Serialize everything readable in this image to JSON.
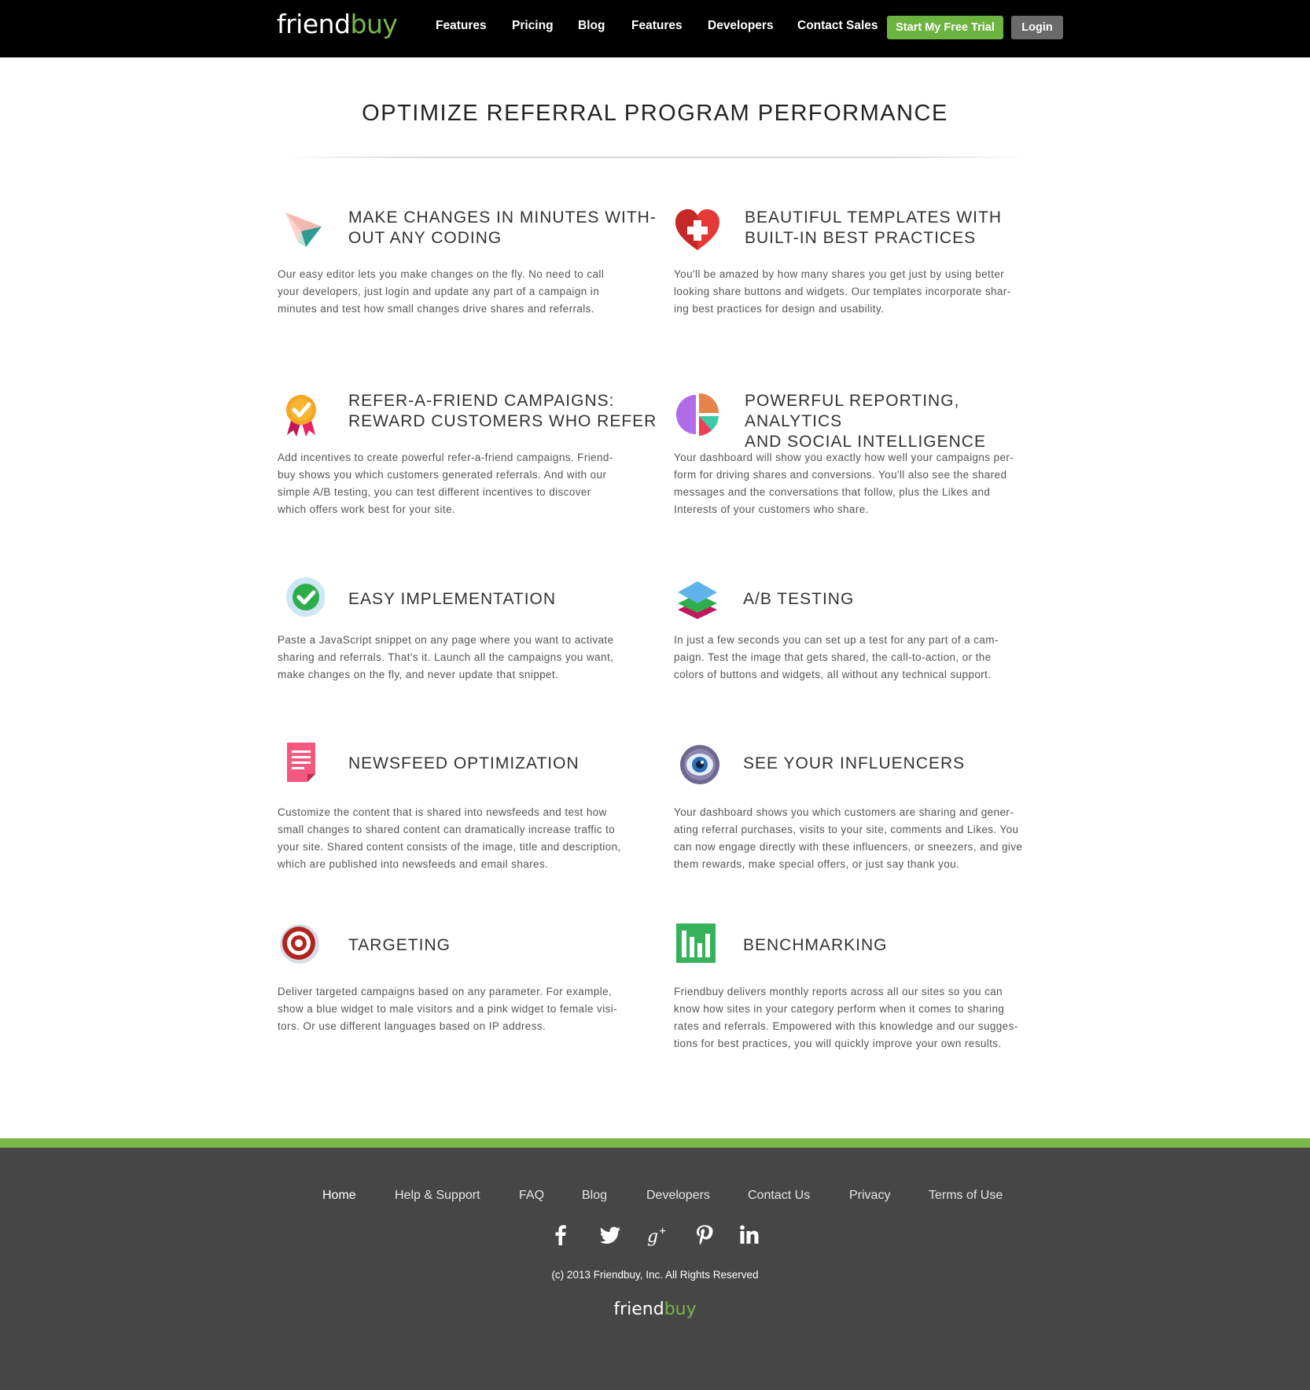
{
  "header": {
    "logo_part1": "friend",
    "logo_part2": "buy",
    "nav": [
      "Features",
      "Pricing",
      "Blog",
      "Features",
      "Developers",
      "Contact Sales"
    ],
    "trial_button": "Start My Free Trial",
    "login_button": "Login"
  },
  "main": {
    "title": "OPTIMIZE REFERRAL PROGRAM PERFORMANCE",
    "features": [
      {
        "icon": "paper-plane-icon",
        "title": "MAKE CHANGES IN MINUTES WITH-\nOUT ANY CODING",
        "body": "Our easy editor lets you make changes on the fly. No need to call\nyour developers, just login and update any part of a campaign in\nminutes and test how small changes drive shares and referrals."
      },
      {
        "icon": "heart-plus-icon",
        "title": "BEAUTIFUL TEMPLATES WITH\nBUILT-IN BEST PRACTICES",
        "body": "You'll be amazed by how many shares you get just by using better\nlooking share buttons and widgets. Our templates incorporate shar-\ning best practices for design and usability."
      },
      {
        "icon": "award-ribbon-icon",
        "title": "REFER-A-FRIEND CAMPAIGNS:\nREWARD CUSTOMERS WHO REFER",
        "body": "Add incentives to create powerful refer-a-friend campaigns. Friend-\nbuy shows you which customers generated referrals. And with our\nsimple A/B testing, you can test different incentives to discover\nwhich offers work best for your site."
      },
      {
        "icon": "pie-chart-icon",
        "title": "POWERFUL REPORTING, ANALYTICS\nAND SOCIAL INTELLIGENCE",
        "body": "Your dashboard will show you exactly how well your campaigns per-\nform for driving shares and conversions. You'll also see the shared\nmessages and the conversations that follow, plus the Likes and\nInterests of your customers who share."
      },
      {
        "icon": "check-circle-icon",
        "title": "EASY IMPLEMENTATION",
        "body": "Paste a JavaScript snippet on any page where you want to activate\nsharing and referrals. That's it. Launch all the campaigns you want,\nmake changes on the fly, and never update that snippet."
      },
      {
        "icon": "layers-icon",
        "title": "A/B TESTING",
        "body": "In just a few seconds you can set up a test for any part of a cam-\npaign. Test the image that gets shared, the call-to-action, or the\ncolors of buttons and widgets, all without any technical support."
      },
      {
        "icon": "document-icon",
        "title": "NEWSFEED OPTIMIZATION",
        "body": "Customize the content that is shared into newsfeeds and test how\nsmall changes to shared content can dramatically increase traffic to\nyour site. Shared content consists of the image, title and description,\nwhich are published into newsfeeds and email shares."
      },
      {
        "icon": "eye-icon",
        "title": "SEE YOUR INFLUENCERS",
        "body": "Your dashboard shows you which customers are sharing and gener-\nating referral purchases, visits to your site, comments and Likes. You\ncan now engage directly with these influencers, or sneezers, and give\nthem rewards, make special offers, or just say thank you."
      },
      {
        "icon": "target-icon",
        "title": "TARGETING",
        "body": "Deliver targeted campaigns based on any parameter. For example,\nshow a blue widget to male visitors and a pink widget to female visi-\ntors. Or use different languages based on IP address."
      },
      {
        "icon": "bar-chart-icon",
        "title": "BENCHMARKING",
        "body": "Friendbuy delivers monthly reports across all our sites so you can\nknow how sites in your category perform when it comes to sharing\nrates and referrals. Empowered with this knowledge and our sugges-\ntions for best practices, you will quickly improve your own results."
      }
    ]
  },
  "footer": {
    "links": [
      "Home",
      "Help & Support",
      "FAQ",
      "Blog",
      "Developers",
      "Contact Us",
      "Privacy",
      "Terms of Use"
    ],
    "social": [
      "facebook-icon",
      "twitter-icon",
      "google-plus-icon",
      "pinterest-icon",
      "linkedin-icon"
    ],
    "copyright": "(c) 2013 Friendbuy, Inc. All Rights Reserved",
    "logo_part1": "friend",
    "logo_part2": "buy"
  },
  "colors": {
    "brand_green": "#7ab648",
    "trial_button": "#6db33f",
    "footer_bg": "#464646"
  }
}
